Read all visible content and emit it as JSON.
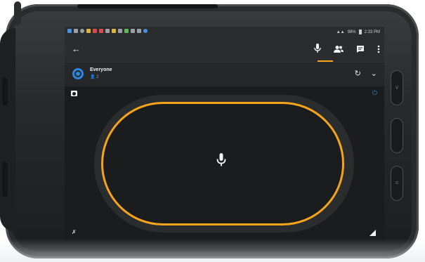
{
  "status_bar": {
    "time": "2:33 PM",
    "battery": "98%"
  },
  "app_bar": {
    "back_icon": "arrow-back-icon",
    "icons": [
      "microphone-icon",
      "contacts-icon",
      "message-icon",
      "more-vert-icon"
    ],
    "active_tab": "microphone",
    "accent_color": "#f4a51c"
  },
  "channel": {
    "name": "Everyone",
    "member_count": "2",
    "icon_color": "#2e86de"
  },
  "ptt": {
    "icon": "microphone-icon"
  }
}
